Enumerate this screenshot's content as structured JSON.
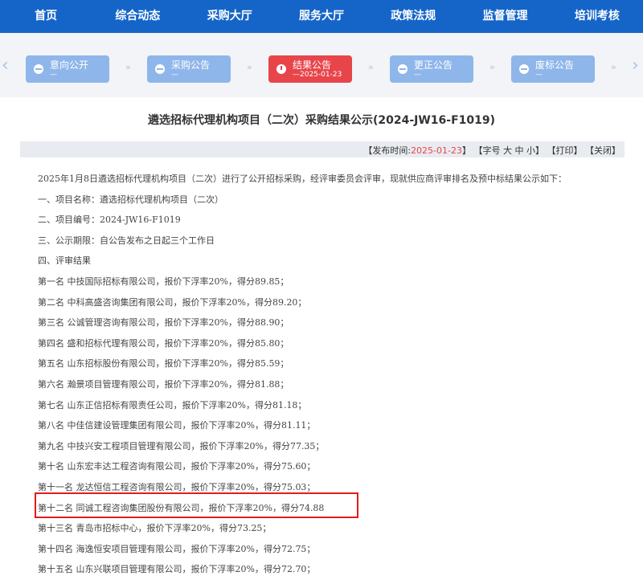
{
  "nav": {
    "items": [
      "首页",
      "综合动态",
      "采购大厅",
      "服务大厅",
      "政策法规",
      "监督管理",
      "培训考核"
    ]
  },
  "process": {
    "arrow_left": "‹",
    "arrow_right": "›",
    "chevron": "»",
    "steps": [
      {
        "label": "意向公开",
        "sub": "—"
      },
      {
        "label": "采购公告",
        "sub": "—"
      },
      {
        "label": "结果公告",
        "sub": "—2025-01-23"
      },
      {
        "label": "更正公告",
        "sub": "—"
      },
      {
        "label": "废标公告",
        "sub": "—"
      }
    ],
    "active_color": "#e8454b",
    "inactive_color": "#8fb6ea"
  },
  "article": {
    "title": "遴选招标代理机构项目（二次）采购结果公示(2024-JW16-F1019)",
    "info": {
      "publish_prefix": "【发布时间:",
      "publish_date": "2025-01-23",
      "publish_suffix": "】",
      "font_label": "【字号 大 中 小】",
      "print_label": "【打印】",
      "close_label": "【关闭】"
    },
    "paragraphs": [
      "2025年1月8日遴选招标代理机构项目（二次）进行了公开招标采购，经评审委员会评审，现就供应商评审排名及预中标结果公示如下：",
      "一、项目名称：遴选招标代理机构项目（二次）",
      "二、项目编号：2024-JW16-F1019",
      "三、公示期限：自公告发布之日起三个工作日",
      "四、评审结果",
      "第一名 中技国际招标有限公司，报价下浮率20%，得分89.85；",
      "第二名 中科高盛咨询集团有限公司，报价下浮率20%，得分89.20；",
      "第三名 公诚管理咨询有限公司，报价下浮率20%，得分88.90；",
      "第四名 盛和招标代理有限公司，报价下浮率20%，得分85.80；",
      "第五名 山东招标股份有限公司，报价下浮率20%，得分85.59；",
      "第六名 瀚景项目管理有限公司，报价下浮率20%，得分81.88；",
      "第七名 山东正信招标有限责任公司，报价下浮率20%，得分81.18；",
      "第八名 中佳信建设管理集团有限公司，报价下浮率20%，得分81.11；",
      "第九名 中技兴安工程项目管理有限公司，报价下浮率20%，得分77.35；",
      "第十名 山东宏丰达工程咨询有限公司，报价下浮率20%，得分75.60；",
      "第十一名 龙达恒信工程咨询有限公司，报价下浮率20%，得分75.03；",
      "第十二名 同诚工程咨询集团股份有限公司，报价下浮率20%，得分74.88",
      "第十三名 青岛市招标中心，报价下浮率20%，得分73.25；",
      "第十四名 海逸恒安项目管理有限公司，报价下浮率20%，得分72.75；",
      "第十五名 山东兴联项目管理有限公司，报价下浮率20%，得分72.70；"
    ]
  }
}
